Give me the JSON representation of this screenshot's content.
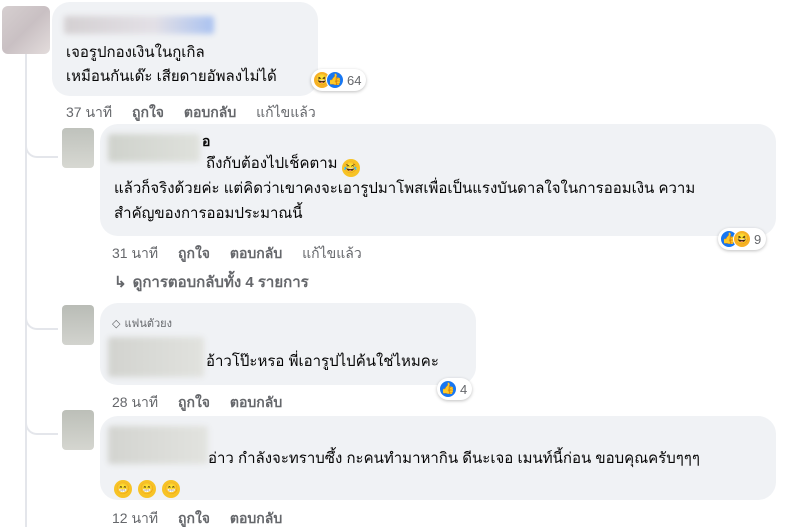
{
  "comment1": {
    "lines": [
      "เจอรูปกองเงินในกูเกิล",
      "เหมือนกันเด๊ะ เสียดายอัพลงไม่ได้"
    ],
    "reaction_count": "64",
    "actions": {
      "time": "37 นาที",
      "like": "ถูกใจ",
      "reply": "ตอบกลับ",
      "edited": "แก้ไขแล้ว"
    }
  },
  "comment2": {
    "name_suffix": "อ",
    "lines": [
      "ถึงกับต้องไปเช็คตาม",
      "แล้วก็จริงด้วยค่ะ แต่คิดว่าเขาคงจะเอารูปมาโพสเพื่อเป็นแรงบันดาลใจในการออมเงิน ความ",
      "สำคัญของการออมประมาณนี้"
    ],
    "reaction_count": "9",
    "actions": {
      "time": "31 นาที",
      "like": "ถูกใจ",
      "reply": "ตอบกลับ",
      "edited": "แก้ไขแล้ว"
    },
    "view_replies": "ดูการตอบกลับทั้ง 4 รายการ"
  },
  "comment3": {
    "badge": "แฟนตัวยง",
    "text": "อ้าวโป๊ะหรอ พี่เอารูปไปค้นใช่ไหมคะ",
    "reaction_count": "4",
    "actions": {
      "time": "28 นาที",
      "like": "ถูกใจ",
      "reply": "ตอบกลับ"
    }
  },
  "comment4": {
    "text": "อ่าว กำลังจะทราบซึ้ง กะคนทำมาหากิน ดีนะเจอ เมนท์นี้ก่อน ขอบคุณครับๆๆๆ",
    "actions": {
      "time": "12 นาที",
      "like": "ถูกใจ",
      "reply": "ตอบกลับ"
    }
  },
  "icons": {
    "haha": "😆",
    "like": "👍",
    "grin": "😁",
    "laugh_tears": "😂",
    "reply_arrow": "↳",
    "diamond": "◇"
  },
  "colors": {
    "bubble": "#f0f2f5",
    "meta": "#65676b",
    "like_blue": "#1877f2",
    "haha_yellow": "#f7b125"
  }
}
